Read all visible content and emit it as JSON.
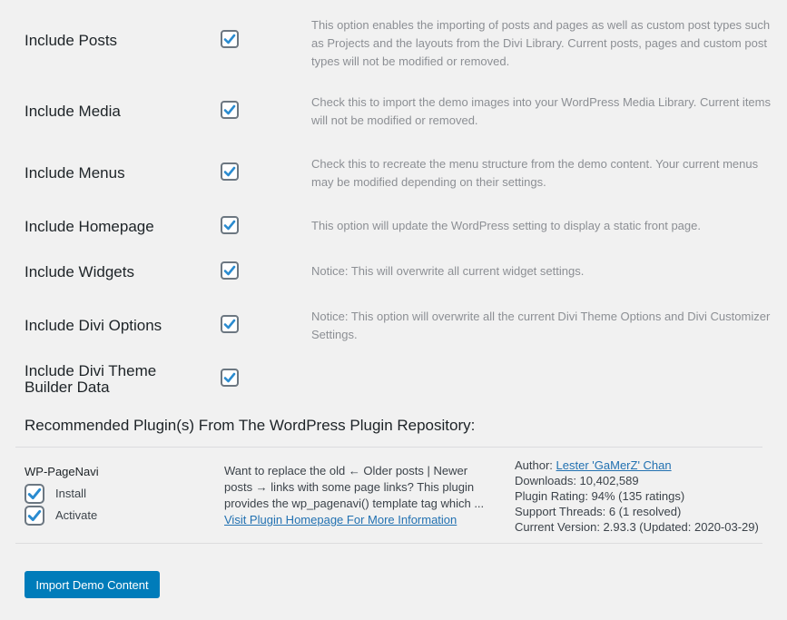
{
  "options": [
    {
      "label": "Include Posts",
      "checked": true,
      "description": "This option enables the importing of posts and pages as well as custom post types such as Projects and the layouts from the Divi Library. Current posts, pages and custom post types will not be modified or removed."
    },
    {
      "label": "Include Media",
      "checked": true,
      "description": "Check this to import the demo images into your WordPress Media Library. Current items will not be modified or removed."
    },
    {
      "label": "Include Menus",
      "checked": true,
      "description": "Check this to recreate the menu structure from the demo content. Your current menus may be modified depending on their settings."
    },
    {
      "label": "Include Homepage",
      "checked": true,
      "description": "This option will update the WordPress setting to display a static front page."
    },
    {
      "label": "Include Widgets",
      "checked": true,
      "description": "Notice: This will overwrite all current widget settings."
    },
    {
      "label": "Include Divi Options",
      "checked": true,
      "description": "Notice: This option will overwrite all the current Divi Theme Options and Divi Customizer Settings."
    },
    {
      "label": "Include Divi Theme Builder Data",
      "checked": true,
      "description": ""
    }
  ],
  "recommended": {
    "title": "Recommended Plugin(s) From The WordPress Plugin Repository:",
    "plugin": {
      "name": "WP-PageNavi",
      "install_label": "Install",
      "install_checked": true,
      "activate_label": "Activate",
      "activate_checked": true,
      "description": "Want to replace the old ← Older posts | Newer posts → links with some page links? This plugin provides the wp_pagenavi() template tag which ...",
      "homepage_link": "Visit Plugin Homepage For More Information",
      "author_label": "Author:",
      "author_name": "Lester 'GaMerZ' Chan",
      "downloads": "Downloads: 10,402,589",
      "rating": "Plugin Rating: 94% (135 ratings)",
      "support": "Support Threads: 6 (1 resolved)",
      "version": "Current Version: 2.93.3 (Updated: 2020-03-29)"
    }
  },
  "import_button": "Import Demo Content",
  "colors": {
    "accent": "#007cba",
    "check": "#2a8bd0",
    "link": "#2271b1"
  }
}
